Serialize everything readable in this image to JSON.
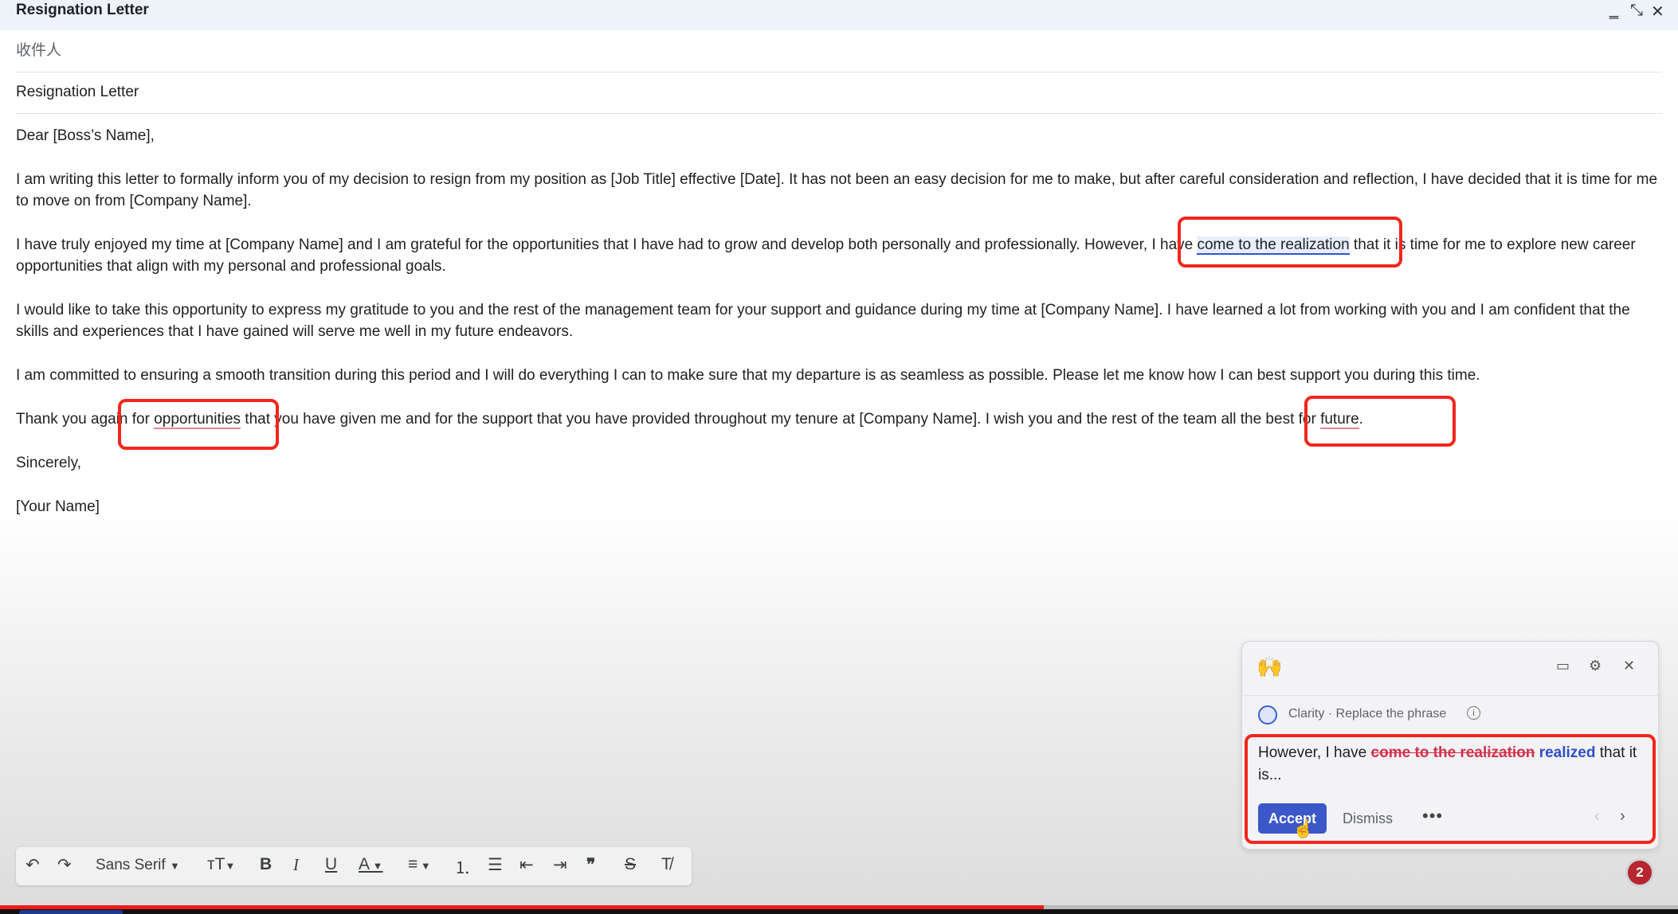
{
  "window": {
    "title": "Resignation Letter"
  },
  "compose": {
    "recipient_placeholder": "收件人",
    "subject": "Resignation Letter"
  },
  "letter": {
    "greeting": "Dear [Boss’s Name],",
    "p1": "I am writing this letter to formally inform you of my decision to resign from my position as [Job Title] effective [Date]. It has not been an easy decision for me to make, but after careful consideration and reflection, I have decided that it is time for me to move on from [Company Name].",
    "p2_before": "I have truly enjoyed my time at [Company Name] and I am grateful for the opportunities that I have had to grow and develop both personally and professionally. However, I have ",
    "p2_highlight": "come to the realization",
    "p2_after": " that it is time for me to explore new career opportunities that align with my personal and professional goals.",
    "p3": "I would like to take this opportunity to express my gratitude to you and the rest of the management team for your support and guidance during my time at [Company Name]. I have learned a lot from working with you and I am confident that the skills and experiences that I have gained will serve me well in my future endeavors.",
    "p4": "I am committed to ensuring a smooth transition during this period and I will do everything I can to make sure that my departure is as seamless as possible. Please let me know how I can best support you during this time.",
    "p5_a": "Thank you again for ",
    "p5_flag1": "opportunities",
    "p5_b": " that you have given me and for the support that you have provided throughout my tenure at [Company Name]. I wish you and the rest of the team all the best for ",
    "p5_flag2": "future",
    "p5_c": ".",
    "closing": "Sincerely,",
    "signature": "[Your Name]"
  },
  "suggestion": {
    "emoji": "🙌",
    "category": "Clarity · Replace the phrase",
    "text_before": "However, I have ",
    "text_deleted": "come to the realization",
    "text_inserted": "realized",
    "text_after": " that it is...",
    "accept_label": "Accept",
    "dismiss_label": "Dismiss",
    "more_label": "•••"
  },
  "toolbar": {
    "undo": "↶",
    "redo": "↷",
    "font": "Sans Serif",
    "size": "тT",
    "bold": "B",
    "italic": "I",
    "underline": "U",
    "text_color": "A",
    "align": "≡",
    "numbered": "⒈",
    "bulleted": "☰",
    "indent_less": "⇤",
    "indent_more": "⇥",
    "quote": "❞",
    "strike": "S",
    "clear": "T̸"
  },
  "badge_count": "2",
  "colors": {
    "accent": "#3b57c8",
    "callout": "#f2261c",
    "error_underline": "#e3839a"
  }
}
